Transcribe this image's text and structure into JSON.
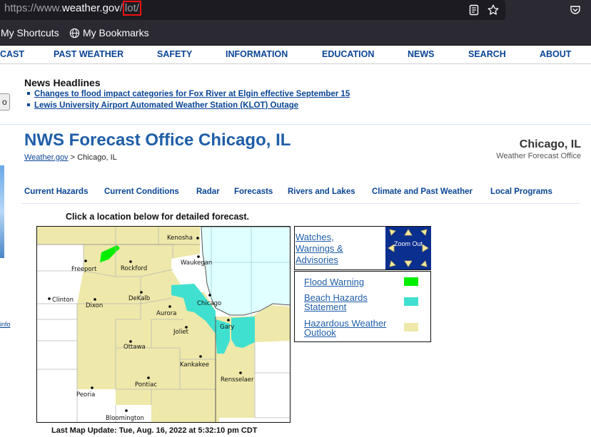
{
  "browser": {
    "url_prefix": "https://www.",
    "url_host": "weather.gov",
    "url_slash": "/",
    "url_path": "lot/",
    "icons": [
      "reader-view-icon",
      "star-bookmark-icon",
      "pocket-icon"
    ],
    "bookmarks": [
      {
        "label": "My Shortcuts"
      },
      {
        "label": "My Bookmarks",
        "icon": "globe-icon"
      }
    ]
  },
  "nav": {
    "items": [
      "CAST",
      "PAST WEATHER",
      "SAFETY",
      "INFORMATION",
      "EDUCATION",
      "NEWS",
      "SEARCH",
      "ABOUT"
    ]
  },
  "left_button_label": "o",
  "left_info_label": "info",
  "news": {
    "title": "News Headlines",
    "items": [
      "Changes to flood impact categories for Fox River at Elgin effective September 15",
      "Lewis University Airport Automated Weather Station (KLOT) Outage"
    ]
  },
  "office": {
    "title": "NWS Forecast Office Chicago, IL",
    "breadcrumb_link": "Weather.gov",
    "breadcrumb_sep": " > ",
    "breadcrumb_current": "Chicago, IL",
    "city": "Chicago, IL",
    "subtitle": "Weather Forecast Office"
  },
  "subnav": [
    "Current Hazards",
    "Current Conditions",
    "Radar",
    "Forecasts",
    "Rivers and Lakes",
    "Climate and Past Weather",
    "Local Programs"
  ],
  "map": {
    "instruction": "Click a location below for detailed forecast.",
    "last_update": "Last Map Update: Tue, Aug. 16, 2022 at 5:32:10 pm CDT",
    "cities": [
      "Kenosha",
      "Waukegan",
      "Freeport",
      "Rockford",
      "Clinton",
      "DeKalb",
      "Chicago",
      "Dixon",
      "Aurora",
      "Gary",
      "Joliet",
      "Ottawa",
      "Kankakee",
      "Rensselaer",
      "Pontiac",
      "Peoria",
      "Bloomington"
    ],
    "colors": {
      "flood_warning": "#00ee00",
      "beach_hazards": "#40e0d0",
      "hazardous_outlook": "#eee8aa",
      "lake": "#e0ffff"
    }
  },
  "watch": {
    "link": "Watches, Warnings & Advisories",
    "zoom": "Zoom Out",
    "zoom_color": "#0a2f8f",
    "arrow_color": "#f7e8a0"
  },
  "legend": [
    {
      "label": "Flood Warning",
      "color": "#00ee00"
    },
    {
      "label": "Beach Hazards Statement",
      "color": "#40e0d0"
    },
    {
      "label": "Hazardous Weather Outlook",
      "color": "#eee8aa"
    }
  ]
}
